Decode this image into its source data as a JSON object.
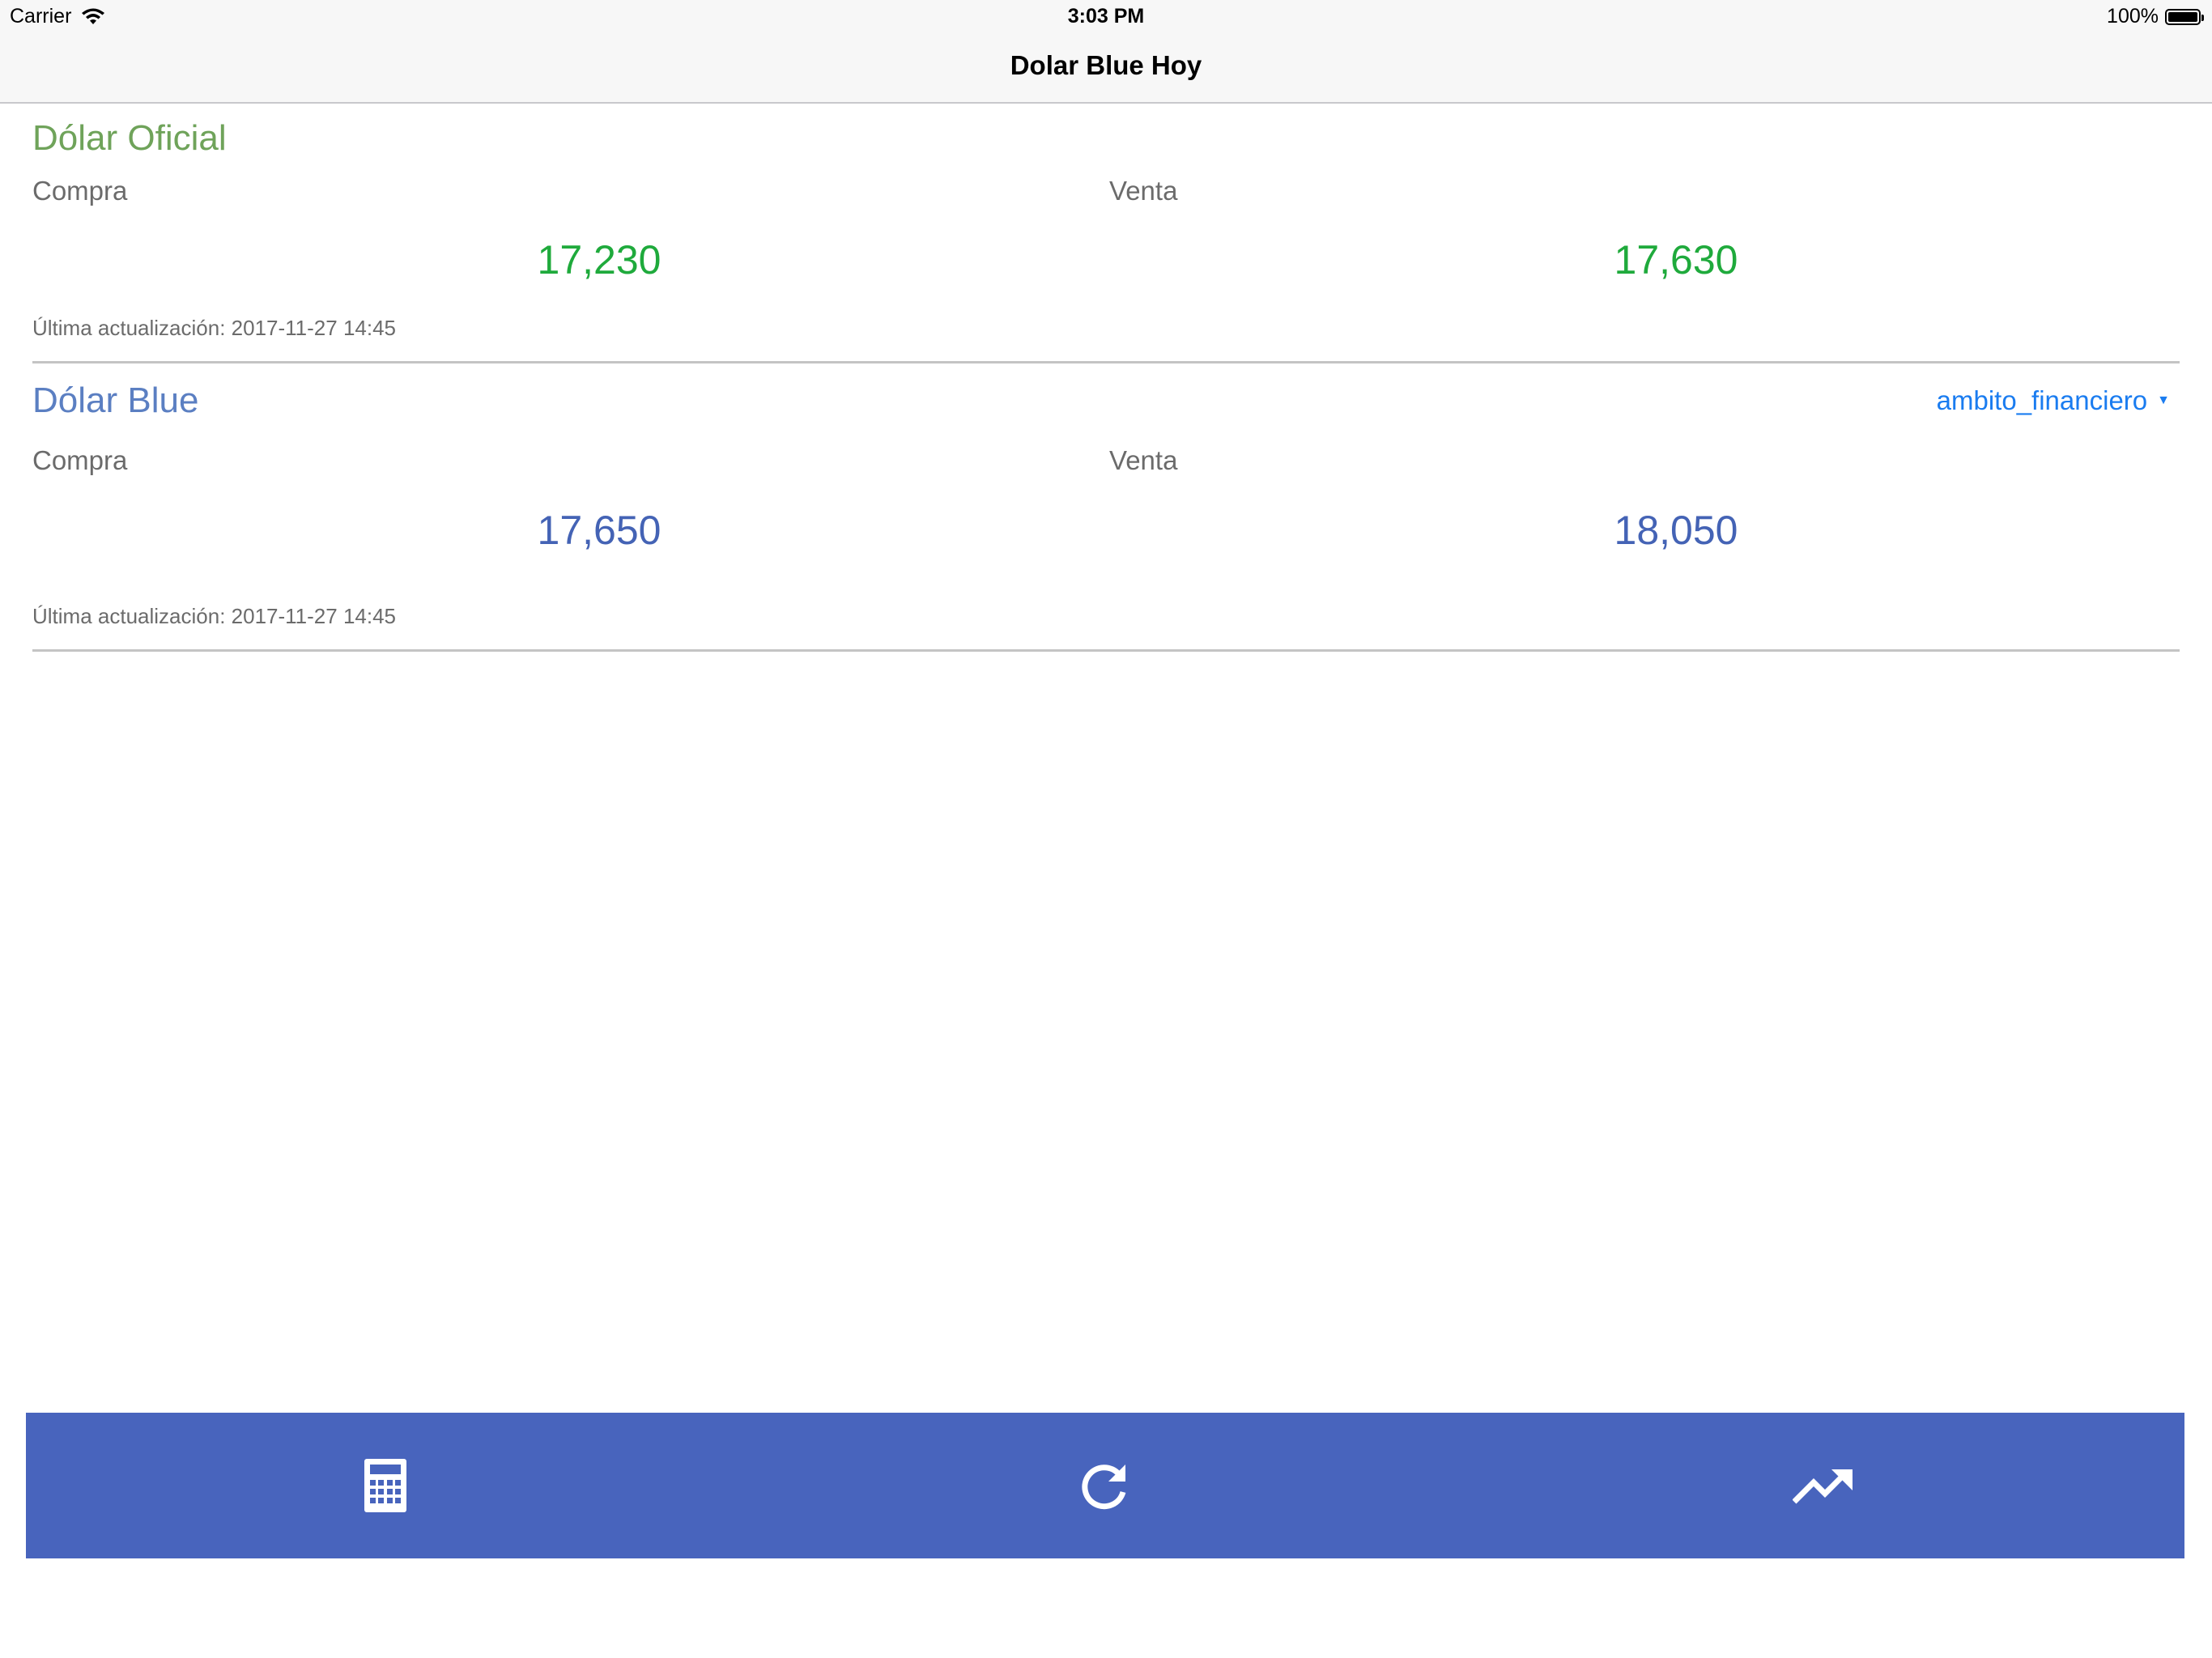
{
  "status_bar": {
    "carrier": "Carrier",
    "time": "3:03 PM",
    "battery": "100%"
  },
  "nav": {
    "title": "Dolar Blue Hoy"
  },
  "oficial": {
    "title": "Dólar Oficial",
    "title_color": "#6fa35a",
    "compra_label": "Compra",
    "venta_label": "Venta",
    "compra_value": "17,230",
    "venta_value": "17,630",
    "value_color": "#1faa3c",
    "updated": "Última actualización: 2017-11-27 14:45"
  },
  "blue": {
    "title": "Dólar Blue",
    "title_color": "#5b7fc2",
    "source": "ambito_financiero",
    "compra_label": "Compra",
    "venta_label": "Venta",
    "compra_value": "17,650",
    "venta_value": "18,050",
    "value_color": "#4463b5",
    "updated": "Última actualización: 2017-11-27 14:45"
  },
  "toolbar": {
    "background": "#4864bd",
    "buttons": [
      {
        "icon": "calculator-icon"
      },
      {
        "icon": "refresh-icon"
      },
      {
        "icon": "trending-up-icon"
      }
    ]
  }
}
